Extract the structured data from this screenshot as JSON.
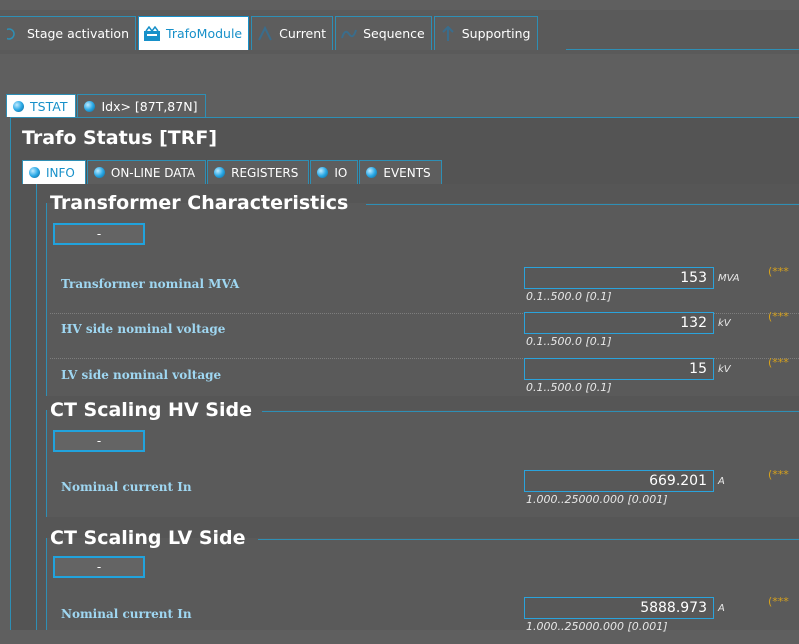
{
  "top_tabs": [
    {
      "label": "Stage activation",
      "icon": "stage-activation-icon"
    },
    {
      "label": "TrafoModule",
      "icon": "trafo-module-icon"
    },
    {
      "label": "Current",
      "icon": "current-icon"
    },
    {
      "label": "Sequence",
      "icon": "sequence-icon"
    },
    {
      "label": "Supporting",
      "icon": "supporting-icon"
    }
  ],
  "sub_tabs": [
    {
      "label": "TSTAT"
    },
    {
      "label": "Idx> [87T,87N]"
    }
  ],
  "page_title": "Trafo Status [TRF]",
  "info_tabs": [
    {
      "label": "INFO"
    },
    {
      "label": "ON-LINE DATA"
    },
    {
      "label": "REGISTERS"
    },
    {
      "label": "IO"
    },
    {
      "label": "EVENTS"
    }
  ],
  "sections": [
    {
      "title": "Transformer Characteristics",
      "button_label": "-",
      "rows": [
        {
          "label": "Transformer nominal MVA",
          "value": "153",
          "unit": "MVA",
          "range": "0.1..500.0 [0.1]",
          "marker": "(***"
        },
        {
          "label": "HV side nominal voltage",
          "value": "132",
          "unit": "kV",
          "range": "0.1..500.0 [0.1]",
          "marker": "(***"
        },
        {
          "label": "LV side nominal voltage",
          "value": "15",
          "unit": "kV",
          "range": "0.1..500.0 [0.1]",
          "marker": "(***"
        }
      ]
    },
    {
      "title": "CT Scaling HV Side",
      "button_label": "-",
      "rows": [
        {
          "label": "Nominal current In",
          "value": "669.201",
          "unit": "A",
          "range": "1.000..25000.000 [0.001]",
          "marker": "(***"
        }
      ]
    },
    {
      "title": "CT Scaling LV Side",
      "button_label": "-",
      "rows": [
        {
          "label": "Nominal current In",
          "value": "5888.973",
          "unit": "A",
          "range": "1.000..25000.000 [0.001]",
          "marker": "(***"
        }
      ]
    }
  ],
  "colors": {
    "accent": "#1790c9",
    "label": "#9fd7f2",
    "marker": "#d7a21c"
  }
}
